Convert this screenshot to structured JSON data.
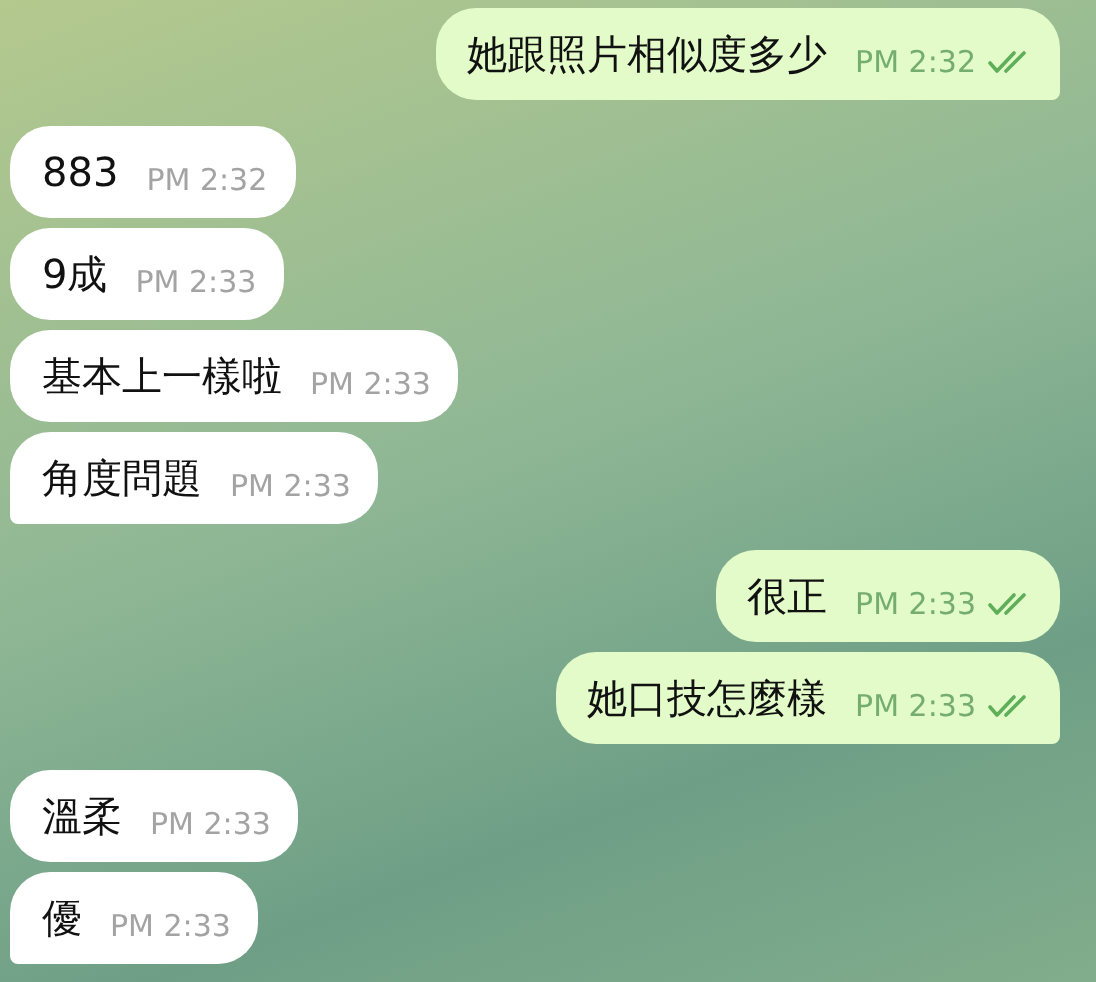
{
  "messages": [
    {
      "kind": "out",
      "text": "她跟照片相似度多少",
      "time": "PM 2:32",
      "read": true
    },
    {
      "kind": "in",
      "text": "883",
      "time": "PM 2:32"
    },
    {
      "kind": "in",
      "text": "9成",
      "time": "PM 2:33"
    },
    {
      "kind": "in",
      "text": "基本上一樣啦",
      "time": "PM 2:33"
    },
    {
      "kind": "in",
      "text": "角度問題",
      "time": "PM 2:33"
    },
    {
      "kind": "out",
      "text": "很正",
      "time": "PM 2:33",
      "read": true
    },
    {
      "kind": "out",
      "text": "她口技怎麼樣",
      "time": "PM 2:33",
      "read": true
    },
    {
      "kind": "in",
      "text": "溫柔",
      "time": "PM 2:33"
    },
    {
      "kind": "in",
      "text": "優",
      "time": "PM 2:33"
    }
  ]
}
